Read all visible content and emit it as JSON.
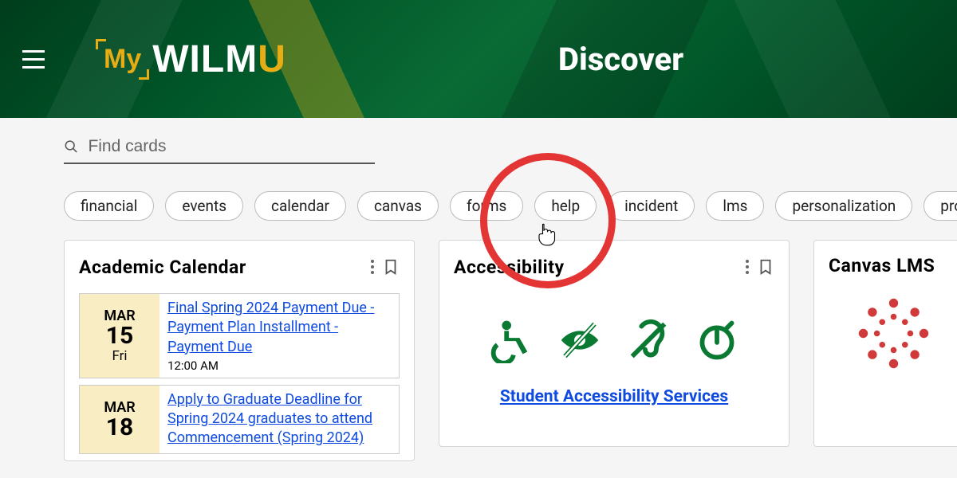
{
  "header": {
    "logo": {
      "my": "My",
      "wilm": "WILM",
      "u": "U"
    },
    "page_title": "Discover"
  },
  "search": {
    "placeholder": "Find cards"
  },
  "chips": [
    "financial",
    "events",
    "calendar",
    "canvas",
    "forms",
    "help",
    "incident",
    "lms",
    "personalization",
    "programs"
  ],
  "cards": {
    "academic_calendar": {
      "title": "Academic  Calendar",
      "events": [
        {
          "month": "MAR",
          "day": "15",
          "dow": "Fri",
          "title": "Final Spring 2024 Payment Due - Payment Plan Installment - Payment Due",
          "time": "12:00 AM"
        },
        {
          "month": "MAR",
          "day": "18",
          "dow": "",
          "title": "Apply to Graduate Deadline for Spring 2024 graduates to attend Commencement (Spring 2024)",
          "time": ""
        }
      ]
    },
    "accessibility": {
      "title": "Accessibility",
      "link_label": "Student Accessibility Services"
    },
    "canvas": {
      "title": "Canvas  LMS"
    }
  },
  "colors": {
    "brand_green": "#0a7a33",
    "brand_gold": "#e6ad15",
    "link_blue": "#0f4be0",
    "annotation_red": "#e43535"
  }
}
